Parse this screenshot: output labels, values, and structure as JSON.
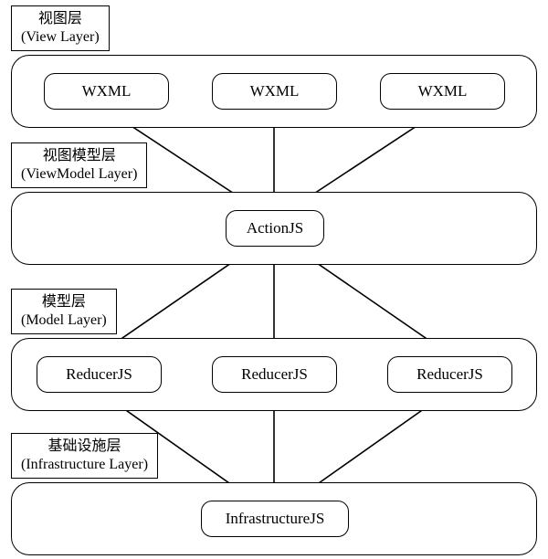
{
  "layers": {
    "view": {
      "title_cn": "视图层",
      "title_en": "(View Layer)"
    },
    "viewmodel": {
      "title_cn": "视图模型层",
      "title_en": "(ViewModel Layer)"
    },
    "model": {
      "title_cn": "模型层",
      "title_en": "(Model Layer)"
    },
    "infra": {
      "title_cn": "基础设施层",
      "title_en": "(Infrastructure Layer)"
    }
  },
  "nodes": {
    "wxml1": "WXML",
    "wxml2": "WXML",
    "wxml3": "WXML",
    "actionjs": "ActionJS",
    "reducer1": "ReducerJS",
    "reducer2": "ReducerJS",
    "reducer3": "ReducerJS",
    "infrajs": "InfrastructureJS"
  },
  "edges": [
    {
      "from": "wxml1",
      "to": "actionjs",
      "bidirectional": true
    },
    {
      "from": "wxml2",
      "to": "actionjs",
      "bidirectional": true
    },
    {
      "from": "wxml3",
      "to": "actionjs",
      "bidirectional": true
    },
    {
      "from": "actionjs",
      "to": "reducer1",
      "bidirectional": false
    },
    {
      "from": "actionjs",
      "to": "reducer2",
      "bidirectional": false
    },
    {
      "from": "actionjs",
      "to": "reducer3",
      "bidirectional": false
    },
    {
      "from": "reducer1",
      "to": "infrajs",
      "bidirectional": false
    },
    {
      "from": "reducer2",
      "to": "infrajs",
      "bidirectional": false
    },
    {
      "from": "reducer3",
      "to": "infrajs",
      "bidirectional": false
    }
  ]
}
